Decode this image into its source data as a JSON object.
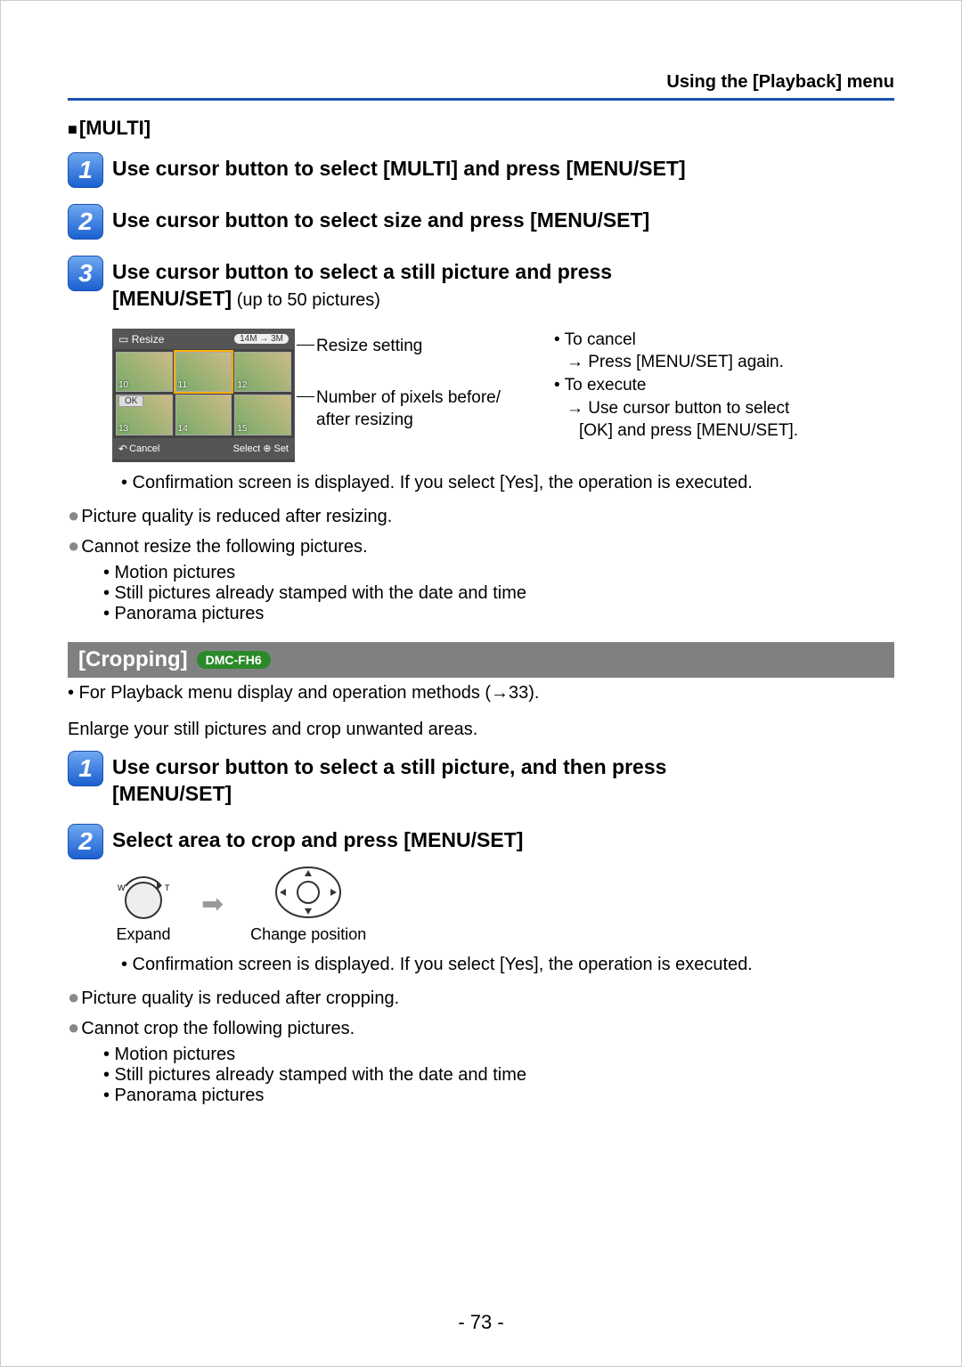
{
  "header": "Using the [Playback] menu",
  "multi": {
    "title": "[MULTI]",
    "step1": "Use cursor button to select [MULTI] and press [MENU/SET]",
    "step2": "Use cursor button to select size and press [MENU/SET]",
    "step3a": "Use cursor button to select a still picture and press",
    "step3b": "[MENU/SET]",
    "step3sub": " (up to 50 pictures)",
    "lcd": {
      "title": "Resize",
      "pill": "14M → 3M",
      "ok": "OK",
      "cancel": "Cancel",
      "select": "Select ⊕ Set",
      "nums": [
        "10",
        "11",
        "12",
        "13",
        "14",
        "15"
      ]
    },
    "annot1": "Resize setting",
    "annot2a": "Number of pixels before/",
    "annot2b": "after resizing",
    "tip1": "To cancel",
    "tip1a": "→ Press [MENU/SET] again.",
    "tip2": "To execute",
    "tip2a": "→ Use cursor button to select",
    "tip2b": "[OK] and press [MENU/SET].",
    "confirm": "• Confirmation screen is displayed. If you select [Yes], the operation is executed."
  },
  "resize_notes": {
    "b1": "Picture quality is reduced after resizing.",
    "b2": "Cannot resize the following pictures.",
    "s1": "• Motion pictures",
    "s2": "• Still pictures already stamped with the date and time",
    "s3": "• Panorama pictures"
  },
  "cropping": {
    "heading": "[Cropping]",
    "badge": "DMC-FH6",
    "ref": "• For Playback menu display and operation methods (→33).",
    "intro": "Enlarge your still pictures and crop unwanted areas.",
    "step1a": "Use cursor button to select a still picture, and then press",
    "step1b": "[MENU/SET]",
    "step2": "Select area to crop and press [MENU/SET]",
    "expand": "Expand",
    "changepos": "Change position",
    "confirm": "• Confirmation screen is displayed. If you select [Yes], the operation is executed."
  },
  "crop_notes": {
    "b1": "Picture quality is reduced after cropping.",
    "b2": "Cannot crop the following pictures.",
    "s1": "• Motion pictures",
    "s2": "• Still pictures already stamped with the date and time",
    "s3": "• Panorama pictures"
  },
  "page": "- 73 -"
}
